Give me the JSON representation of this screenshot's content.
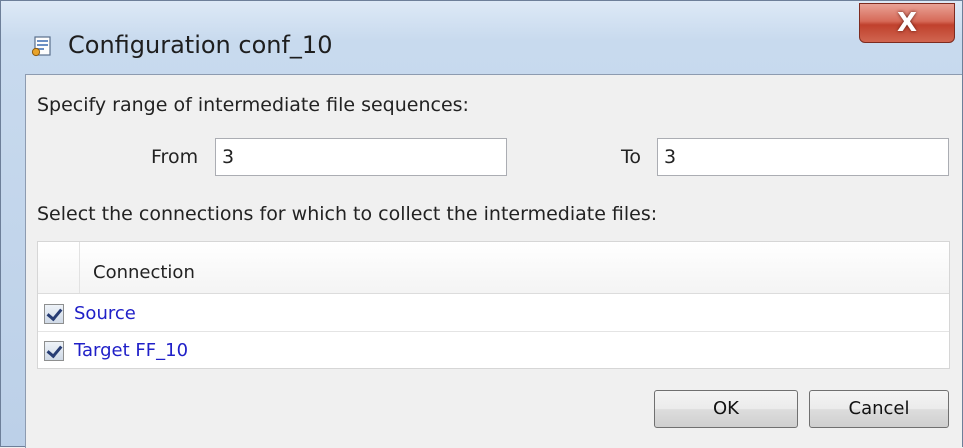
{
  "window": {
    "title": "Configuration conf_10",
    "close_label": "X",
    "icon": "config-dialog-icon"
  },
  "range": {
    "label": "Specify range of intermediate file sequences:",
    "from_label": "From",
    "from_value": "3",
    "to_label": "To",
    "to_value": "3"
  },
  "connections": {
    "label": "Select the connections for which to collect the intermediate files:",
    "column_header": "Connection",
    "rows": [
      {
        "name": "Source",
        "checked": true
      },
      {
        "name": "Target FF_10",
        "checked": true
      }
    ]
  },
  "buttons": {
    "ok": "OK",
    "cancel": "Cancel"
  },
  "colors": {
    "link_text": "#2020c8",
    "close_button": "#c0412d"
  }
}
